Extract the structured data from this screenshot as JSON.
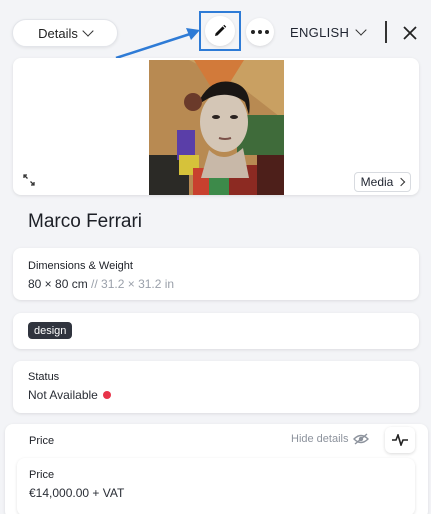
{
  "header": {
    "details_label": "Details",
    "language_label": "ENGLISH"
  },
  "media": {
    "media_button_label": "Media"
  },
  "artwork": {
    "title": "Marco Ferrari"
  },
  "dimensions": {
    "label": "Dimensions & Weight",
    "cm_value": "80 × 80 cm",
    "in_value": " // 31.2 × 31.2 in"
  },
  "tags": [
    "design"
  ],
  "status": {
    "label": "Status",
    "value": "Not Available",
    "dot_color": "#e8344a"
  },
  "price": {
    "section_label": "Price",
    "hide_details_label": "Hide details",
    "card_label": "Price",
    "card_value": "€14,000.00 + VAT"
  },
  "colors": {
    "highlight": "#2e7bd6",
    "background": "#f3f4f7",
    "tag_bg": "#30343e"
  },
  "icons": [
    "chevron-down-icon",
    "pencil-icon",
    "more-icon",
    "close-icon",
    "expand-icon",
    "chevron-right-icon",
    "eye-off-icon",
    "pulse-icon"
  ]
}
